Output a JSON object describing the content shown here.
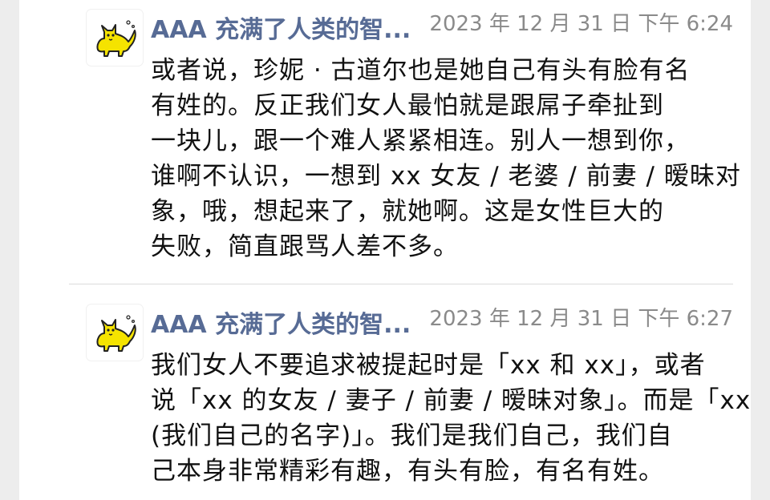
{
  "messages": [
    {
      "sender": "AAA 充满了人类的智...",
      "time": "2023 年 12 月 31 日 下午 6:24",
      "lines": [
        "或者说，珍妮 · 古道尔也是她自己有头有脸有名",
        "有姓的。反正我们女人最怕就是跟屌子牵扯到",
        "一块儿，跟一个难人紧紧相连。别人一想到你，",
        "谁啊不认识，一想到 xx 女友 / 老婆 / 前妻 / 暧昧对",
        "象，哦，想起来了，就她啊。这是女性巨大的",
        "失败，简直跟骂人差不多。"
      ]
    },
    {
      "sender": "AAA 充满了人类的智...",
      "time": "2023 年 12 月 31 日 下午 6:27",
      "lines": [
        "我们女人不要追求被提起时是「xx 和 xx」，或者",
        "说「xx 的女友 / 妻子 / 前妻 / 暧昧对象」。而是「xx",
        "(我们自己的名字)」。我们是我们自己，我们自",
        "己本身非常精彩有趣，有头有脸，有名有姓。"
      ]
    }
  ],
  "avatar_icon": "yellow-cat-icon",
  "colors": {
    "sender_name": "#576b95",
    "timestamp": "#8a8a8a",
    "text": "#111111",
    "avatar_cat": "#f5e300"
  }
}
